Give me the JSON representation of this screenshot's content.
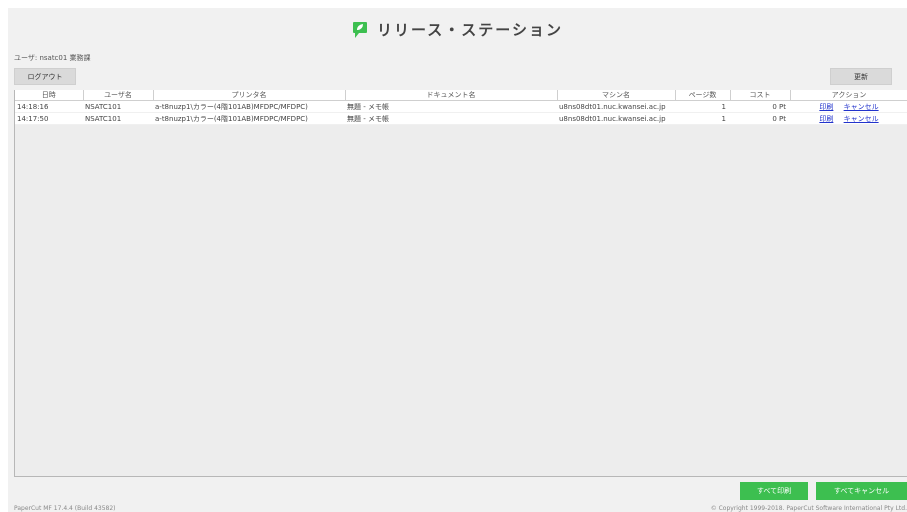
{
  "header": {
    "title": "リリース・ステーション",
    "logo_icon": "papercut-leaf-logo",
    "accent_color": "#3dbf50"
  },
  "user": {
    "line": "ユーザ: nsatc01  業務課"
  },
  "toolbar": {
    "logout_label": "ログアウト",
    "refresh_label": "更新"
  },
  "table": {
    "columns": [
      "日時",
      "ユーザ名",
      "プリンタ名",
      "ドキュメント名",
      "マシン名",
      "ページ数",
      "コスト",
      "アクション"
    ],
    "rows": [
      {
        "time": "14:18:16",
        "user": "NSATC101",
        "printer": "a-t8nuzp1\\カラー(4階101AB)MFDPC/MFDPC)",
        "document": "無題 - メモ帳",
        "machine": "u8ns08dt01.nuc.kwansei.ac.jp",
        "pages": "1",
        "cost": "0 Pt",
        "print_label": "印刷",
        "cancel_label": "キャンセル"
      },
      {
        "time": "14:17:50",
        "user": "NSATC101",
        "printer": "a-t8nuzp1\\カラー(4階101AB)MFDPC/MFDPC)",
        "document": "無題 - メモ帳",
        "machine": "u8ns08dt01.nuc.kwansei.ac.jp",
        "pages": "1",
        "cost": "0 Pt",
        "print_label": "印刷",
        "cancel_label": "キャンセル"
      }
    ]
  },
  "actions": {
    "print_all_label": "すべて印刷",
    "cancel_all_label": "すべてキャンセル"
  },
  "footer": {
    "version": "PaperCut MF 17.4.4 (Build 43582)",
    "copyright": "© Copyright 1999-2018. PaperCut Software International Pty Ltd."
  }
}
